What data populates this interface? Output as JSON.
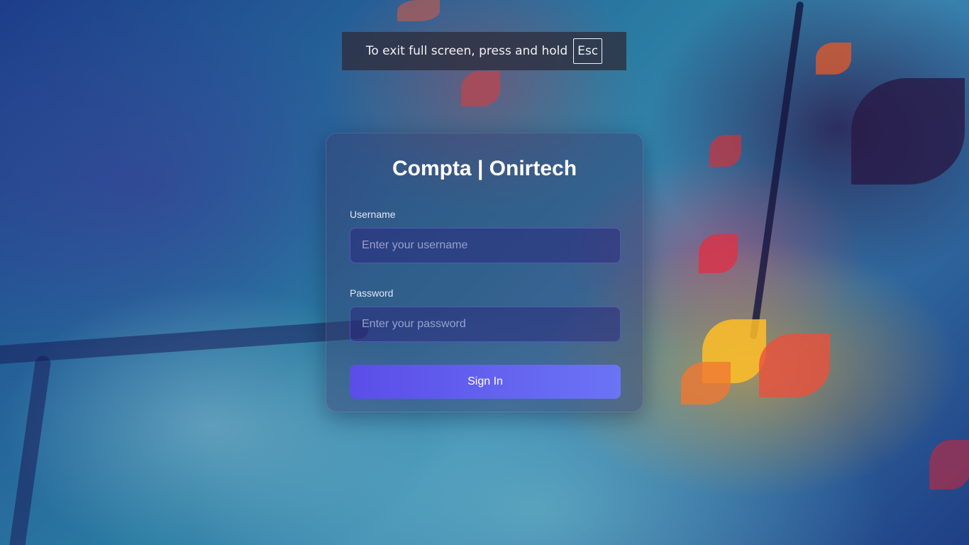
{
  "fullscreen_notice": {
    "text": "To exit full screen, press and hold",
    "key": "Esc"
  },
  "login": {
    "title": "Compta | Onirtech",
    "username_label": "Username",
    "username_placeholder": "Enter your username",
    "password_label": "Password",
    "password_placeholder": "Enter your password",
    "submit_label": "Sign In"
  },
  "colors": {
    "button_start": "#5b4de8",
    "button_end": "#6b74f5",
    "card_tint": "#373c6e"
  }
}
